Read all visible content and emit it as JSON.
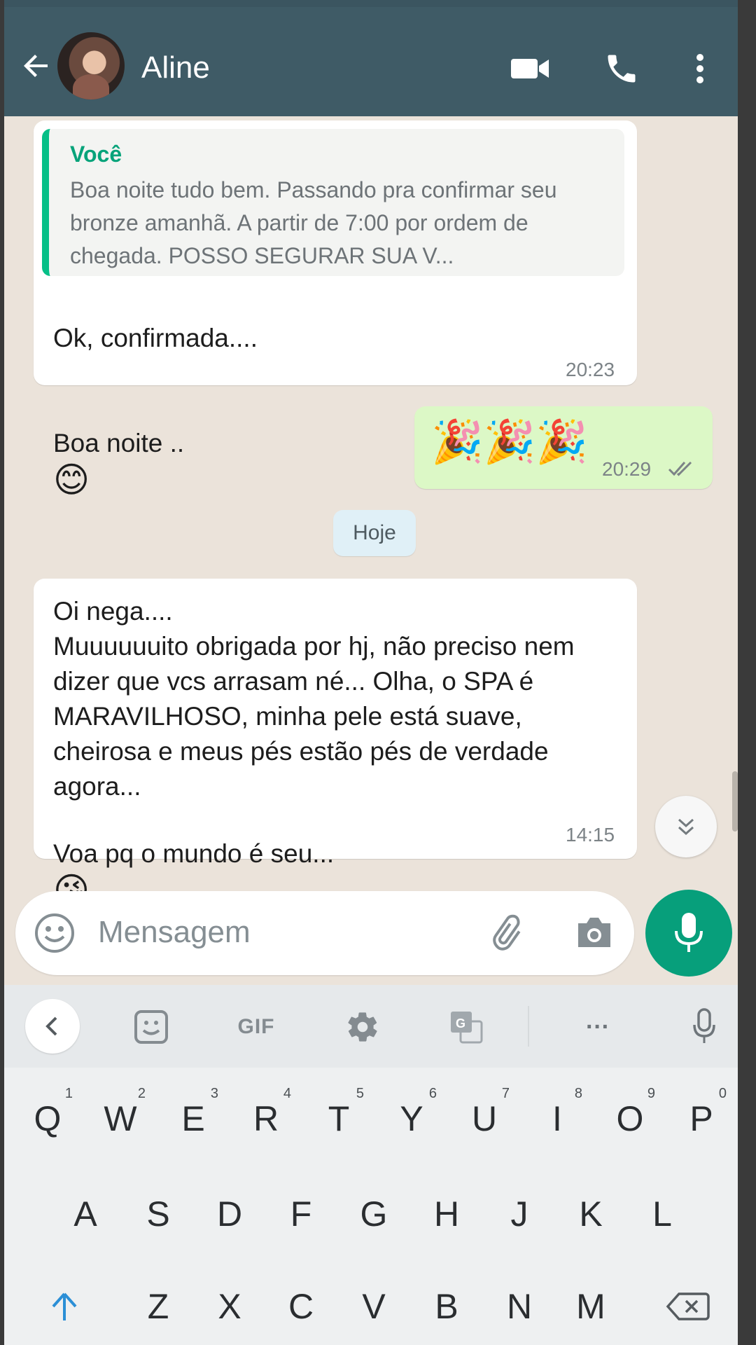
{
  "header": {
    "contact_name": "Aline",
    "icons": [
      "back-arrow-icon",
      "video-call-icon",
      "phone-call-icon",
      "more-vertical-icon"
    ]
  },
  "messages": [
    {
      "direction": "incoming",
      "quote_author": "Você",
      "quote_text": "Boa noite tudo bem. Passando pra confirmar seu bronze amanhã. A partir de 7:00 por ordem de chegada. POSSO SEGURAR SUA V...",
      "line1": "Ok, confirmada....",
      "line2": "Boa noite ..",
      "emoji": "😊",
      "time": "20:23"
    },
    {
      "direction": "outgoing",
      "emoji": "🎉🎉🎉",
      "time": "20:29",
      "status": "read"
    },
    {
      "direction": "incoming",
      "body": "Oi nega....\nMuuuuuuito obrigada por hj, não preciso nem dizer que vcs arrasam né... Olha, o SPA é MARAVILHOSO, minha pele está suave, cheirosa e meus pés estão pés de verdade agora...",
      "last_line": "Voa pq o mundo é seu...",
      "emoji": "😘",
      "time": "14:15"
    }
  ],
  "date_separator": "Hoje",
  "composer": {
    "placeholder": "Mensagem"
  },
  "keyboard": {
    "toolbar": {
      "gif_label": "GIF",
      "more_label": "···"
    },
    "row1": [
      {
        "key": "Q",
        "hint": "1"
      },
      {
        "key": "W",
        "hint": "2"
      },
      {
        "key": "E",
        "hint": "3"
      },
      {
        "key": "R",
        "hint": "4"
      },
      {
        "key": "T",
        "hint": "5"
      },
      {
        "key": "Y",
        "hint": "6"
      },
      {
        "key": "U",
        "hint": "7"
      },
      {
        "key": "I",
        "hint": "8"
      },
      {
        "key": "O",
        "hint": "9"
      },
      {
        "key": "P",
        "hint": "0"
      }
    ],
    "row2": [
      "A",
      "S",
      "D",
      "F",
      "G",
      "H",
      "J",
      "K",
      "L"
    ],
    "row3": [
      "Z",
      "X",
      "C",
      "V",
      "B",
      "N",
      "M"
    ]
  },
  "colors": {
    "header": "#3f5b66",
    "chat_background": "#ebe3da",
    "outgoing_bubble": "#dcf8c6",
    "accent_green": "#079f7b",
    "quote_bar": "#06bf87"
  }
}
